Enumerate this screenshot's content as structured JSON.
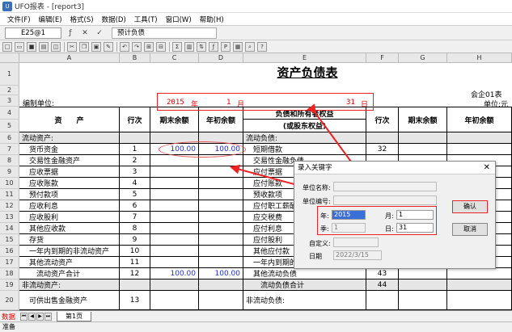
{
  "window": {
    "title": "UFO报表 - [report3]"
  },
  "menu": [
    "文件(F)",
    "编辑(E)",
    "格式(S)",
    "数据(D)",
    "工具(T)",
    "窗口(W)",
    "帮助(H)"
  ],
  "formula": {
    "cell_ref": "E25@1",
    "fx_value": "预计负债"
  },
  "toolbar_icons": [
    "new-icon",
    "open-icon",
    "save-icon",
    "print-icon",
    "preview-icon",
    "cut-icon",
    "copy-icon",
    "paste-icon",
    "format-painter-icon",
    "undo-icon",
    "redo-icon",
    "insert-icon",
    "merge-icon",
    "sum-icon",
    "chart-icon",
    "sort-icon",
    "formula-icon",
    "p-icon",
    "fill-icon",
    "zoom-icon",
    "help-icon"
  ],
  "columns": [
    "A",
    "B",
    "C",
    "D",
    "E",
    "F",
    "G",
    "H"
  ],
  "rows": [
    "1",
    "2",
    "3",
    "4",
    "5",
    "6",
    "7",
    "8",
    "9",
    "10",
    "11",
    "12",
    "13",
    "14",
    "15",
    "16",
    "17",
    "18",
    "19",
    "20"
  ],
  "report": {
    "title": "资产负债表",
    "form_no": "会企01表",
    "unit_label": "编制单位:",
    "unit_right": "单位:元",
    "year": "2015",
    "year_suffix": "年",
    "month": "1",
    "month_suffix": "月",
    "day": "31",
    "day_suffix": "日",
    "header": {
      "asset": "资　　产",
      "line_no": "行次",
      "end_balance": "期末余额",
      "begin_balance": "年初余额",
      "liability": "负债和所有者权益",
      "liability_sub": "(或股东权益)",
      "line_no2": "行次",
      "end_balance2": "期末余额",
      "begin_balance2": "年初余额"
    },
    "asset_rows": [
      {
        "name": "流动资产:",
        "line": "",
        "end": "",
        "begin": ""
      },
      {
        "name": "　货币资金",
        "line": "1",
        "end": "100.00",
        "begin": "100.00"
      },
      {
        "name": "　交易性金融资产",
        "line": "2",
        "end": "",
        "begin": ""
      },
      {
        "name": "　应收票据",
        "line": "3",
        "end": "",
        "begin": ""
      },
      {
        "name": "　应收账款",
        "line": "4",
        "end": "",
        "begin": ""
      },
      {
        "name": "　预付款项",
        "line": "5",
        "end": "",
        "begin": ""
      },
      {
        "name": "　应收利息",
        "line": "6",
        "end": "",
        "begin": ""
      },
      {
        "name": "　应收股利",
        "line": "7",
        "end": "",
        "begin": ""
      },
      {
        "name": "　其他应收款",
        "line": "8",
        "end": "",
        "begin": ""
      },
      {
        "name": "　存货",
        "line": "9",
        "end": "",
        "begin": ""
      },
      {
        "name": "　一年内到期的非流动资产",
        "line": "10",
        "end": "",
        "begin": ""
      },
      {
        "name": "　其他流动资产",
        "line": "11",
        "end": "",
        "begin": ""
      },
      {
        "name": "　　流动资产合计",
        "line": "12",
        "end": "100.00",
        "begin": "100.00"
      },
      {
        "name": "非流动资产:",
        "line": "",
        "end": "",
        "begin": ""
      },
      {
        "name": "　可供出售金融资产",
        "line": "13",
        "end": "",
        "begin": ""
      }
    ],
    "liab_rows": [
      {
        "name": "流动负债:",
        "line": ""
      },
      {
        "name": "　短期借款",
        "line": "32"
      },
      {
        "name": "　交易性金融负债",
        "line": ""
      },
      {
        "name": "　应付票据",
        "line": ""
      },
      {
        "name": "　应付账款",
        "line": ""
      },
      {
        "name": "　预收款项",
        "line": ""
      },
      {
        "name": "　应付职工薪酬",
        "line": ""
      },
      {
        "name": "　应交税费",
        "line": ""
      },
      {
        "name": "　应付利息",
        "line": ""
      },
      {
        "name": "　应付股利",
        "line": ""
      },
      {
        "name": "　其他应付款",
        "line": ""
      },
      {
        "name": "　一年内到期的非流动负债",
        "line": "42"
      },
      {
        "name": "　其他流动负债",
        "line": "43"
      },
      {
        "name": "　　流动负债合计",
        "line": "44"
      },
      {
        "name": "非流动负债:",
        "line": ""
      }
    ]
  },
  "dialog": {
    "title": "录入关键字",
    "unit_name_label": "单位名称:",
    "unit_code_label": "单位编号:",
    "year_label": "年:",
    "year_value": "2015",
    "month_label": "月:",
    "month_value": "1",
    "quarter_label": "季:",
    "quarter_value": "1",
    "day_label": "日:",
    "day_value": "31",
    "custom_label": "自定义:",
    "date_label": "日期",
    "date_value": "2022/3/15",
    "ok": "确认",
    "cancel": "取消"
  },
  "bottom": {
    "mode": "数据",
    "sheet_tab": "第1页"
  },
  "status": "准备"
}
